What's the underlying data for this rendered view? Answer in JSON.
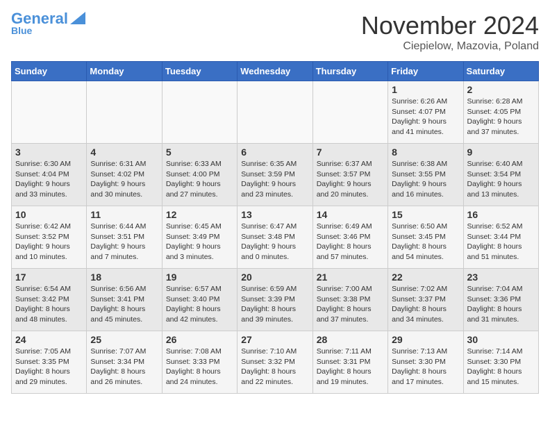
{
  "logo": {
    "line1": "General",
    "line2": "Blue"
  },
  "title": "November 2024",
  "subtitle": "Ciepielow, Mazovia, Poland",
  "days_of_week": [
    "Sunday",
    "Monday",
    "Tuesday",
    "Wednesday",
    "Thursday",
    "Friday",
    "Saturday"
  ],
  "weeks": [
    [
      {
        "day": "",
        "detail": ""
      },
      {
        "day": "",
        "detail": ""
      },
      {
        "day": "",
        "detail": ""
      },
      {
        "day": "",
        "detail": ""
      },
      {
        "day": "",
        "detail": ""
      },
      {
        "day": "1",
        "detail": "Sunrise: 6:26 AM\nSunset: 4:07 PM\nDaylight: 9 hours and 41 minutes."
      },
      {
        "day": "2",
        "detail": "Sunrise: 6:28 AM\nSunset: 4:05 PM\nDaylight: 9 hours and 37 minutes."
      }
    ],
    [
      {
        "day": "3",
        "detail": "Sunrise: 6:30 AM\nSunset: 4:04 PM\nDaylight: 9 hours and 33 minutes."
      },
      {
        "day": "4",
        "detail": "Sunrise: 6:31 AM\nSunset: 4:02 PM\nDaylight: 9 hours and 30 minutes."
      },
      {
        "day": "5",
        "detail": "Sunrise: 6:33 AM\nSunset: 4:00 PM\nDaylight: 9 hours and 27 minutes."
      },
      {
        "day": "6",
        "detail": "Sunrise: 6:35 AM\nSunset: 3:59 PM\nDaylight: 9 hours and 23 minutes."
      },
      {
        "day": "7",
        "detail": "Sunrise: 6:37 AM\nSunset: 3:57 PM\nDaylight: 9 hours and 20 minutes."
      },
      {
        "day": "8",
        "detail": "Sunrise: 6:38 AM\nSunset: 3:55 PM\nDaylight: 9 hours and 16 minutes."
      },
      {
        "day": "9",
        "detail": "Sunrise: 6:40 AM\nSunset: 3:54 PM\nDaylight: 9 hours and 13 minutes."
      }
    ],
    [
      {
        "day": "10",
        "detail": "Sunrise: 6:42 AM\nSunset: 3:52 PM\nDaylight: 9 hours and 10 minutes."
      },
      {
        "day": "11",
        "detail": "Sunrise: 6:44 AM\nSunset: 3:51 PM\nDaylight: 9 hours and 7 minutes."
      },
      {
        "day": "12",
        "detail": "Sunrise: 6:45 AM\nSunset: 3:49 PM\nDaylight: 9 hours and 3 minutes."
      },
      {
        "day": "13",
        "detail": "Sunrise: 6:47 AM\nSunset: 3:48 PM\nDaylight: 9 hours and 0 minutes."
      },
      {
        "day": "14",
        "detail": "Sunrise: 6:49 AM\nSunset: 3:46 PM\nDaylight: 8 hours and 57 minutes."
      },
      {
        "day": "15",
        "detail": "Sunrise: 6:50 AM\nSunset: 3:45 PM\nDaylight: 8 hours and 54 minutes."
      },
      {
        "day": "16",
        "detail": "Sunrise: 6:52 AM\nSunset: 3:44 PM\nDaylight: 8 hours and 51 minutes."
      }
    ],
    [
      {
        "day": "17",
        "detail": "Sunrise: 6:54 AM\nSunset: 3:42 PM\nDaylight: 8 hours and 48 minutes."
      },
      {
        "day": "18",
        "detail": "Sunrise: 6:56 AM\nSunset: 3:41 PM\nDaylight: 8 hours and 45 minutes."
      },
      {
        "day": "19",
        "detail": "Sunrise: 6:57 AM\nSunset: 3:40 PM\nDaylight: 8 hours and 42 minutes."
      },
      {
        "day": "20",
        "detail": "Sunrise: 6:59 AM\nSunset: 3:39 PM\nDaylight: 8 hours and 39 minutes."
      },
      {
        "day": "21",
        "detail": "Sunrise: 7:00 AM\nSunset: 3:38 PM\nDaylight: 8 hours and 37 minutes."
      },
      {
        "day": "22",
        "detail": "Sunrise: 7:02 AM\nSunset: 3:37 PM\nDaylight: 8 hours and 34 minutes."
      },
      {
        "day": "23",
        "detail": "Sunrise: 7:04 AM\nSunset: 3:36 PM\nDaylight: 8 hours and 31 minutes."
      }
    ],
    [
      {
        "day": "24",
        "detail": "Sunrise: 7:05 AM\nSunset: 3:35 PM\nDaylight: 8 hours and 29 minutes."
      },
      {
        "day": "25",
        "detail": "Sunrise: 7:07 AM\nSunset: 3:34 PM\nDaylight: 8 hours and 26 minutes."
      },
      {
        "day": "26",
        "detail": "Sunrise: 7:08 AM\nSunset: 3:33 PM\nDaylight: 8 hours and 24 minutes."
      },
      {
        "day": "27",
        "detail": "Sunrise: 7:10 AM\nSunset: 3:32 PM\nDaylight: 8 hours and 22 minutes."
      },
      {
        "day": "28",
        "detail": "Sunrise: 7:11 AM\nSunset: 3:31 PM\nDaylight: 8 hours and 19 minutes."
      },
      {
        "day": "29",
        "detail": "Sunrise: 7:13 AM\nSunset: 3:30 PM\nDaylight: 8 hours and 17 minutes."
      },
      {
        "day": "30",
        "detail": "Sunrise: 7:14 AM\nSunset: 3:30 PM\nDaylight: 8 hours and 15 minutes."
      }
    ]
  ]
}
